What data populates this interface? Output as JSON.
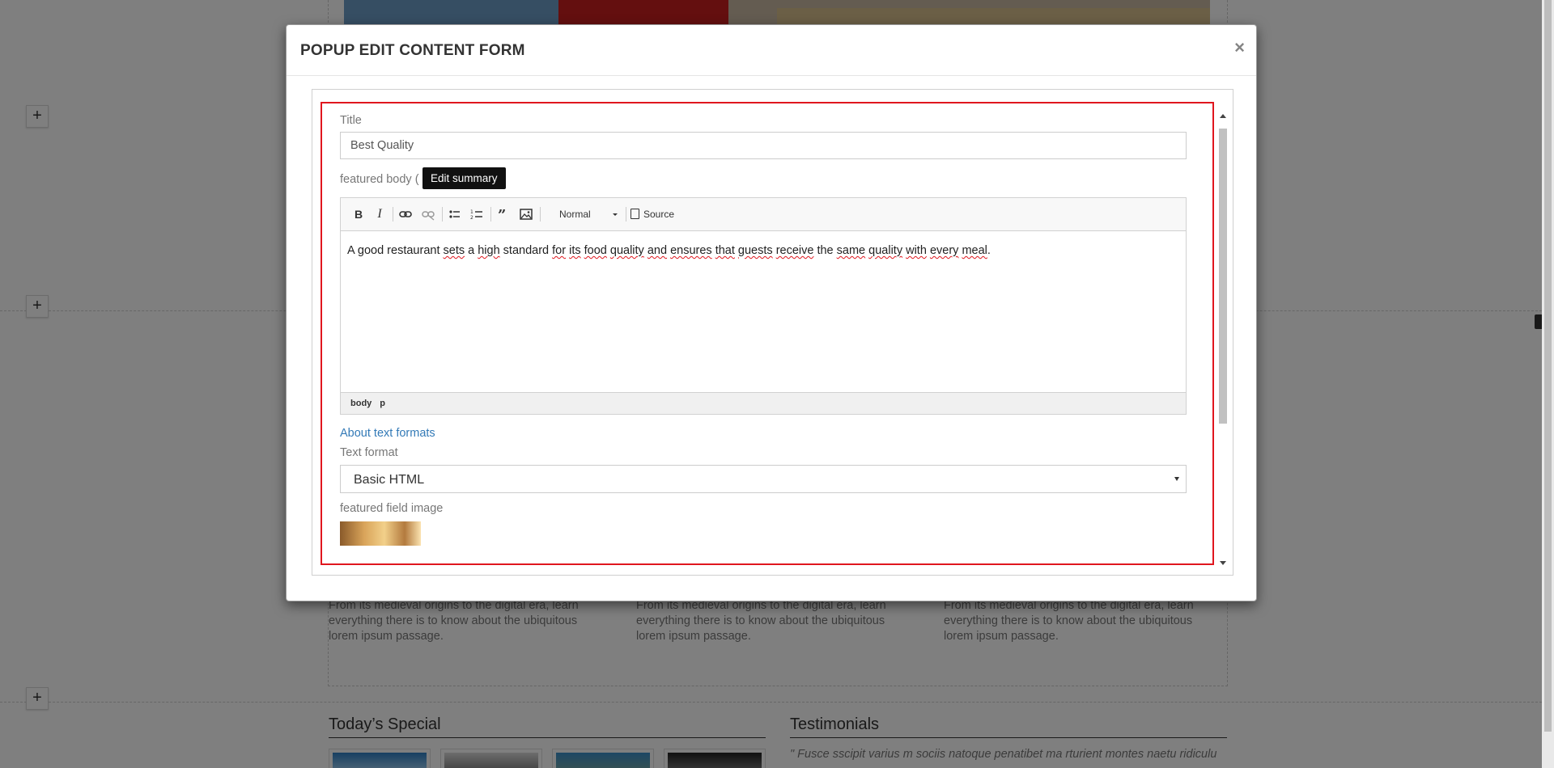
{
  "background": {
    "teaser_text": "From its medieval origins to the digital era, learn everything there is to know about the ubiquitous lorem ipsum passage.",
    "todays_special_title": "Today’s Special",
    "testimonials_title": "Testimonials",
    "testimonial_text": "\" Fusce sscipit varius m sociis natoque penatibet ma rturient montes naetu ridiculu",
    "add_section_label": "+"
  },
  "modal": {
    "title": "POPUP EDIT CONTENT FORM",
    "close_label": "×",
    "title_field": {
      "label": "Title",
      "value": "Best Quality"
    },
    "body_field": {
      "label_prefix": "featured body (",
      "label_suffix": ")",
      "tooltip": "Edit summary"
    },
    "editor": {
      "toolbar": {
        "bold": "B",
        "italic": "I",
        "format_select": "Normal",
        "source": "Source"
      },
      "content_words": [
        "A good restaurant ",
        "sets",
        " a ",
        "high",
        " standard ",
        "for",
        " ",
        "its",
        " ",
        "food",
        " ",
        "quality",
        " ",
        "and",
        " ",
        "ensures",
        " ",
        "that",
        " ",
        "guests",
        " ",
        "receive",
        " the ",
        "same",
        " ",
        "quality",
        " ",
        "with",
        " ",
        "every",
        " ",
        "meal",
        "."
      ],
      "path": [
        "body",
        "p"
      ]
    },
    "about_text_formats": "About text formats",
    "text_format": {
      "label": "Text format",
      "selected": "Basic HTML"
    },
    "image_field": {
      "label": "featured field image"
    }
  }
}
